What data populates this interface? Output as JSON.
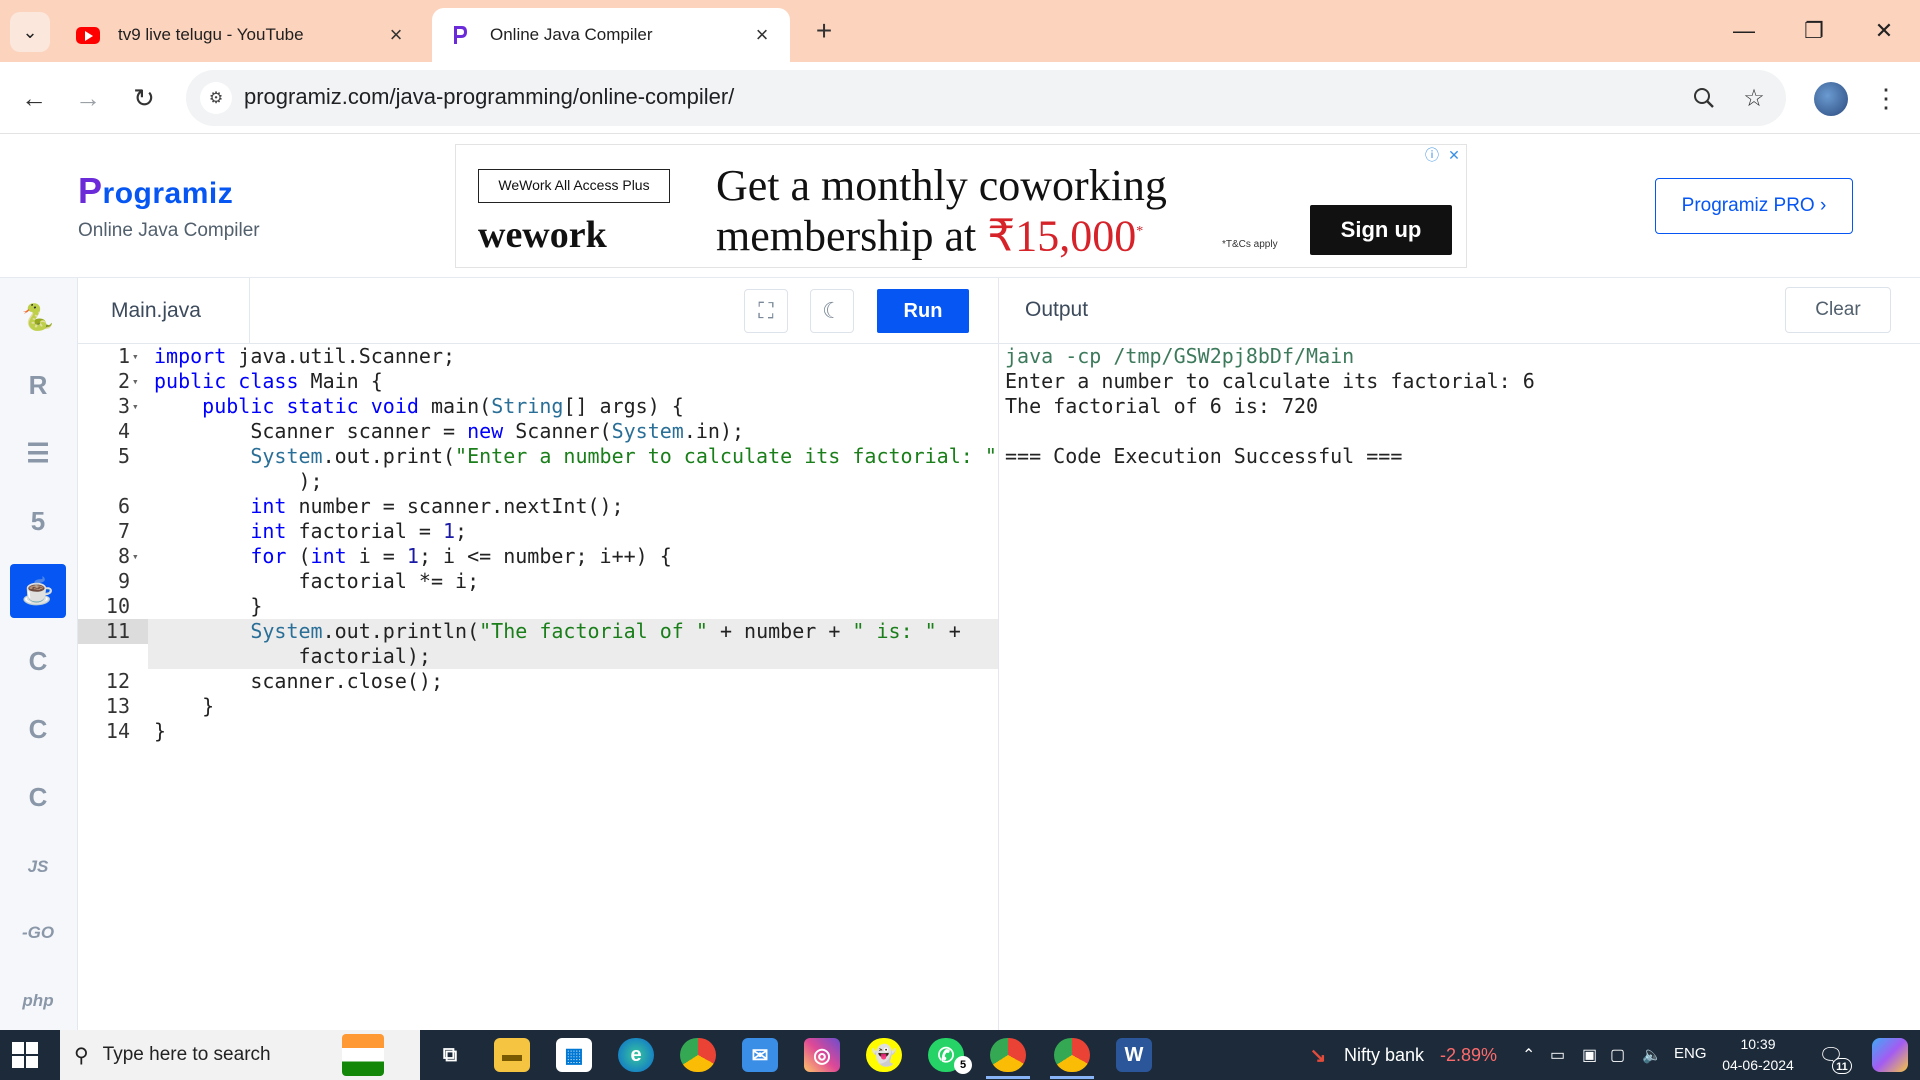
{
  "browser": {
    "tabs": [
      {
        "title": "tv9 live telugu - YouTube",
        "icon": "youtube-icon",
        "active": false
      },
      {
        "title": "Online Java Compiler",
        "icon": "programiz-icon",
        "active": true
      }
    ],
    "url": "programiz.com/java-programming/online-compiler/"
  },
  "header": {
    "logo_text": "rogramiz",
    "logo_letter": "P",
    "subtitle": "Online Java Compiler",
    "pro_button": "Programiz PRO ›"
  },
  "ad": {
    "plan_box": "WeWork All Access Plus",
    "brand": "wework",
    "headline_1": "Get a monthly coworking",
    "headline_2": "membership at ",
    "price": "₹15,000",
    "price_mark": "*",
    "terms": "*T&Cs apply",
    "cta": "Sign up"
  },
  "languages": [
    {
      "name": "python-icon",
      "glyph": "🐍",
      "active": false
    },
    {
      "name": "r-icon",
      "glyph": "R",
      "active": false
    },
    {
      "name": "sql-icon",
      "glyph": "☰",
      "active": false
    },
    {
      "name": "html-icon",
      "glyph": "5",
      "active": false
    },
    {
      "name": "java-icon",
      "glyph": "☕",
      "active": true
    },
    {
      "name": "c-icon",
      "glyph": "C",
      "active": false
    },
    {
      "name": "cpp-icon",
      "glyph": "C",
      "active": false
    },
    {
      "name": "csharp-icon",
      "glyph": "C",
      "active": false
    },
    {
      "name": "js-icon",
      "glyph": "JS",
      "active": false
    },
    {
      "name": "go-icon",
      "glyph": "-GO",
      "active": false
    },
    {
      "name": "php-icon",
      "glyph": "php",
      "active": false
    }
  ],
  "editor": {
    "file_name": "Main.java",
    "run_label": "Run",
    "active_line": 11,
    "lines": [
      {
        "n": "1",
        "fold": true,
        "code": "import java.util.Scanner;"
      },
      {
        "n": "2",
        "fold": true,
        "code": "public class Main {"
      },
      {
        "n": "3",
        "fold": true,
        "code": "    public static void main(String[] args) {"
      },
      {
        "n": "4",
        "fold": false,
        "code": "        Scanner scanner = new Scanner(System.in);"
      },
      {
        "n": "5",
        "fold": false,
        "code": "        System.out.print(\"Enter a number to calculate its factorial: \""
      },
      {
        "n": "",
        "fold": false,
        "code": "            );"
      },
      {
        "n": "6",
        "fold": false,
        "code": "        int number = scanner.nextInt();"
      },
      {
        "n": "7",
        "fold": false,
        "code": "        int factorial = 1;"
      },
      {
        "n": "8",
        "fold": true,
        "code": "        for (int i = 1; i <= number; i++) {"
      },
      {
        "n": "9",
        "fold": false,
        "code": "            factorial *= i;"
      },
      {
        "n": "10",
        "fold": false,
        "code": "        }"
      },
      {
        "n": "11",
        "fold": false,
        "code": "        System.out.println(\"The factorial of \" + number + \" is: \" +"
      },
      {
        "n": "",
        "fold": false,
        "code": "            factorial);"
      },
      {
        "n": "12",
        "fold": false,
        "code": "        scanner.close();"
      },
      {
        "n": "13",
        "fold": false,
        "code": "    }"
      },
      {
        "n": "14",
        "fold": false,
        "code": "}"
      }
    ]
  },
  "output": {
    "title": "Output",
    "clear_label": "Clear",
    "lines": [
      {
        "text": "java -cp /tmp/GSW2pj8bDf/Main",
        "kind": "cmd"
      },
      {
        "text": "Enter a number to calculate its factorial: 6",
        "kind": "out"
      },
      {
        "text": "The factorial of 6 is: 720",
        "kind": "out"
      },
      {
        "text": "",
        "kind": "out"
      },
      {
        "text": "=== Code Execution Successful ===",
        "kind": "out"
      }
    ]
  },
  "taskbar": {
    "search_placeholder": "Type here to search",
    "stock_name": "Nifty bank",
    "stock_change": "-2.89%",
    "language": "ENG",
    "time": "10:39",
    "date": "04-06-2024",
    "whatsapp_badge": "5",
    "notification_badge": "11"
  },
  "colors": {
    "accent": "#0556f3",
    "tabbar": "#fcd3bd",
    "stock_down": "#ff6b6b"
  }
}
